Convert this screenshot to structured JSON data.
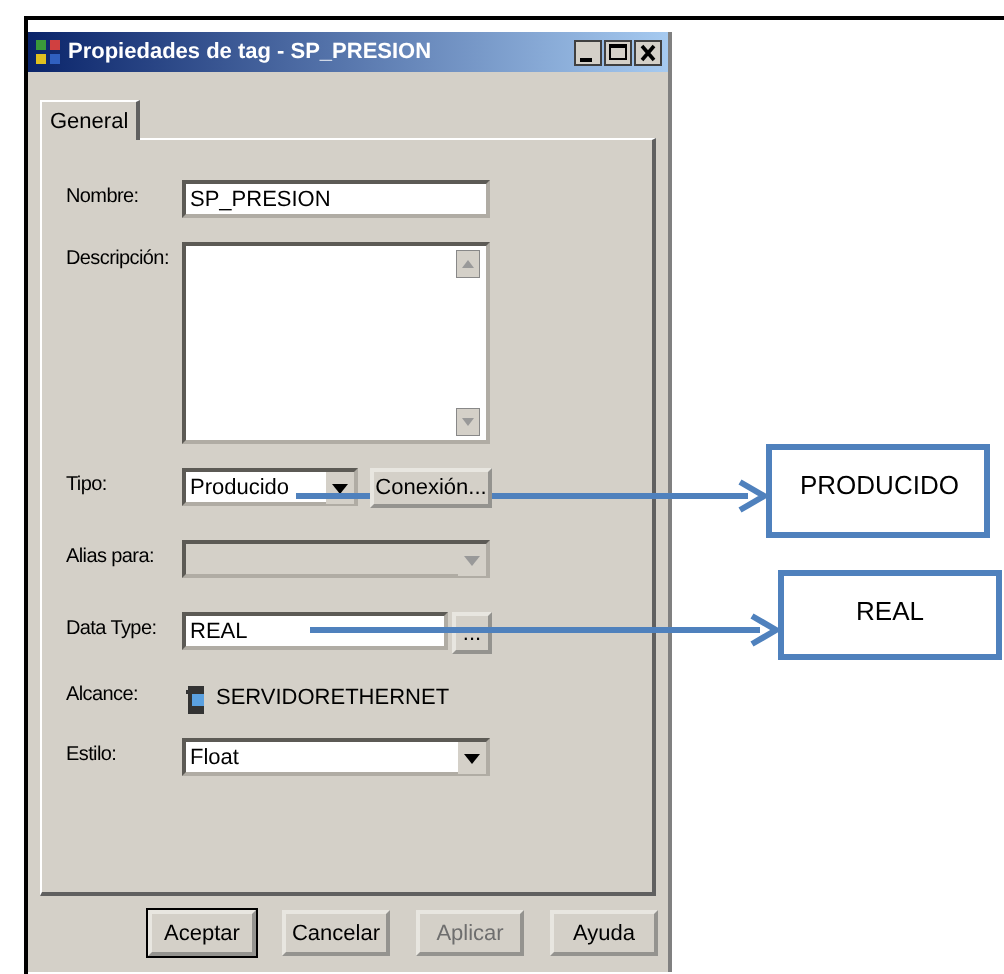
{
  "window": {
    "title": "Propiedades de tag - SP_PRESION"
  },
  "tabs": [
    {
      "label": "General",
      "selected": true
    }
  ],
  "fields": [
    {
      "kind": "text",
      "label": "Nombre:",
      "value": "SP_PRESION"
    },
    {
      "kind": "textarea",
      "label": "Descripción:"
    },
    {
      "kind": "combo-button",
      "label": "Tipo:",
      "value": "Producido",
      "button": "Conexión..."
    },
    {
      "kind": "combo",
      "label": "Alias para:",
      "disabled": true
    },
    {
      "kind": "text-button",
      "label": "Data Type:",
      "value": "REAL",
      "button": "..."
    },
    {
      "kind": "scope",
      "label": "Alcance:",
      "value": "SERVIDORETHERNET"
    },
    {
      "kind": "combo",
      "label": "Estilo:",
      "value": "Float",
      "disabled": false
    }
  ],
  "buttons": [
    {
      "label": "Aceptar",
      "disabled": false
    },
    {
      "label": "Cancelar",
      "disabled": false
    },
    {
      "label": "Aplicar",
      "disabled": true
    },
    {
      "label": "Ayuda",
      "disabled": false
    }
  ],
  "callouts": [
    {
      "text": "PRODUCIDO"
    },
    {
      "text": "REAL"
    }
  ]
}
